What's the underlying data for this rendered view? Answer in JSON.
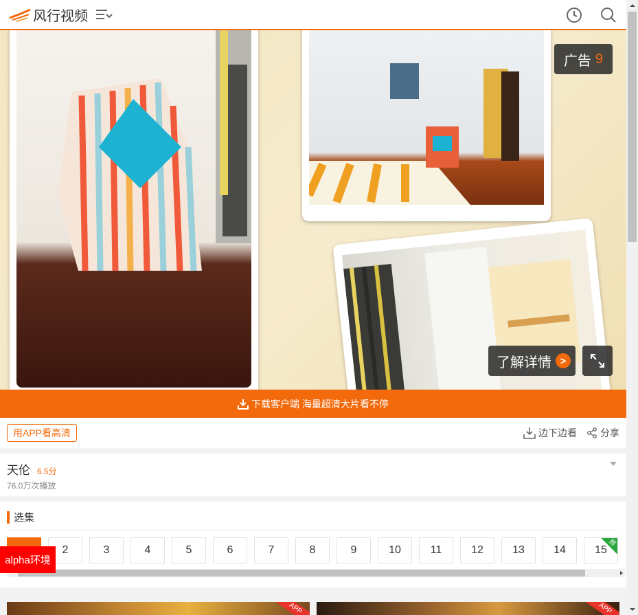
{
  "header": {
    "logo_text": "风行视频",
    "menu_icon": "list-menu-icon",
    "history_icon": "clock-icon",
    "search_icon": "search-icon"
  },
  "player": {
    "ad_label": "广告",
    "ad_countdown": "9",
    "detail_label": "了解详情",
    "detail_arrow": ">",
    "fullscreen_icon": "fullscreen-icon"
  },
  "download_bar": {
    "label": "下载客户端 海量超清大片看不停"
  },
  "toolbar": {
    "app_hd_label": "用APP看高清",
    "download_label": "边下边看",
    "share_label": "分享"
  },
  "info": {
    "title": "天伦",
    "score": "6.5分",
    "play_count": "76.0万次播放"
  },
  "episodes": {
    "title": "选集",
    "items": [
      "",
      "2",
      "3",
      "4",
      "5",
      "6",
      "7",
      "8",
      "9",
      "10",
      "11",
      "12",
      "13",
      "14",
      "15"
    ],
    "preview_tag": "预"
  },
  "overlay": {
    "env_badge": "alpha环境"
  },
  "thumbs": {
    "app_tag": "APP"
  },
  "colors": {
    "accent": "#f26a0b",
    "badge_red": "#ff0000",
    "preview_green": "#2aa63c"
  }
}
